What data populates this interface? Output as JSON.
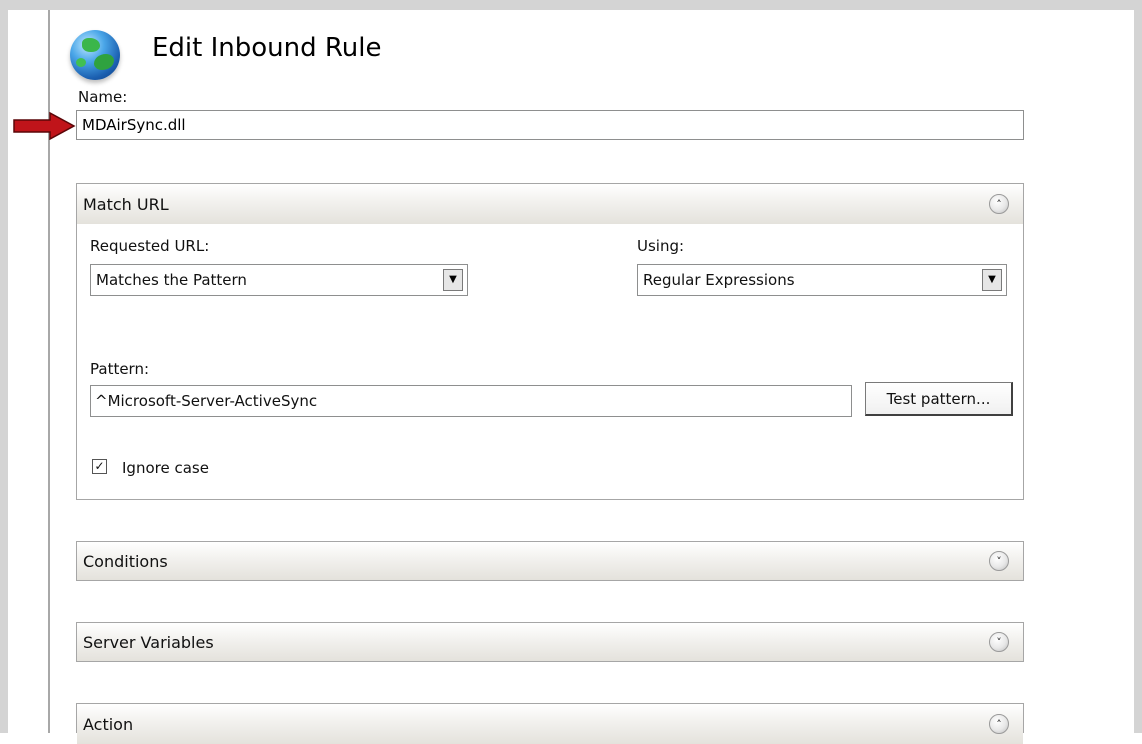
{
  "page": {
    "title": "Edit Inbound Rule"
  },
  "name_field": {
    "label": "Name:",
    "value": "MDAirSync.dll"
  },
  "match_url": {
    "header": "Match URL",
    "requested_url_label": "Requested URL:",
    "requested_url_value": "Matches the Pattern",
    "using_label": "Using:",
    "using_value": "Regular Expressions",
    "pattern_label": "Pattern:",
    "pattern_value": "^Microsoft-Server-ActiveSync",
    "test_button": "Test pattern...",
    "ignore_case_label": "Ignore case",
    "ignore_case_checked": true
  },
  "sections": {
    "conditions": "Conditions",
    "server_variables": "Server Variables",
    "action": "Action"
  },
  "icons": {
    "globe": "globe-icon",
    "arrow": "red-arrow-icon",
    "collapse": "chevron-up-icon",
    "expand": "chevron-down-icon",
    "dropdown": "dropdown-arrow-icon"
  },
  "colors": {
    "arrow": "#c0141a",
    "panel_border": "#a6a6a6"
  }
}
